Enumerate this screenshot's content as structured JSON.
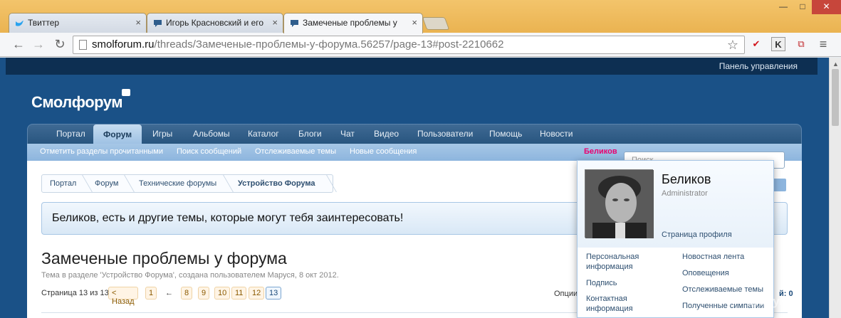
{
  "browser": {
    "tabs": [
      {
        "label": "Твиттер",
        "icon": "twitter-bird-icon",
        "close": "×"
      },
      {
        "label": "Игорь Красновский и его",
        "icon": "speech-bubble-icon",
        "close": "×"
      },
      {
        "label": "Замеченые проблемы у",
        "icon": "speech-bubble-icon",
        "close": "×"
      }
    ],
    "url_host": "smolforum.ru",
    "url_path": "/threads/Замеченые-проблемы-у-форума.56257/page-13#post-2210662",
    "window_buttons": {
      "minimize": "—",
      "maximize": "□",
      "close": "✕"
    },
    "nav": {
      "back": "←",
      "forward": "→",
      "reload": "↻",
      "star": "☆",
      "menu": "≡"
    },
    "extensions": [
      {
        "icon": "red-check-icon",
        "glyph": "✔"
      },
      {
        "icon": "kaspersky-k-icon",
        "glyph": "K"
      },
      {
        "icon": "translate-icon",
        "glyph": "⧉"
      }
    ]
  },
  "site": {
    "top_link": "Панель управления",
    "logo": "Смолфорум",
    "nav": [
      "Портал",
      "Форум",
      "Игры",
      "Альбомы",
      "Каталог",
      "Блоги",
      "Чат",
      "Видео",
      "Пользователи",
      "Помощь",
      "Новости"
    ],
    "active_nav": "Форум",
    "subnav": [
      "Отметить разделы прочитанными",
      "Поиск сообщений",
      "Отслеживаемые темы",
      "Новые сообщения"
    ],
    "visitor_link": "Беликов",
    "search_placeholder": "Поиск..."
  },
  "breadcrumb": [
    "Портал",
    "Форум",
    "Технические форумы",
    "Устройство Форума"
  ],
  "notice": "Беликов, есть и другие темы, которые могут тебя заинтересовать!",
  "thread": {
    "title": "Замеченые проблемы у форума",
    "subtitle": "Тема в разделе 'Устройство Форума', создана пользователем Маруся, 8 окт 2012."
  },
  "pagination": {
    "label": "Страница 13 из 13",
    "prev": "< Назад",
    "first": "1",
    "ellipsis": "←",
    "pages": [
      "8",
      "9",
      "10",
      "11",
      "12",
      "13"
    ],
    "current": "13",
    "options_label": "Опции",
    "right_value": "й: 0"
  },
  "user_popup": {
    "name": "Беликов",
    "role": "Administrator",
    "profile_link": "Страница профиля",
    "left_links": [
      "Персональная информация",
      "Подпись",
      "Контактная информация"
    ],
    "right_links": [
      "Новостная лента",
      "Оповещения",
      "Отслеживаемые темы",
      "Полученные симпатии"
    ]
  },
  "watermark": "форум"
}
